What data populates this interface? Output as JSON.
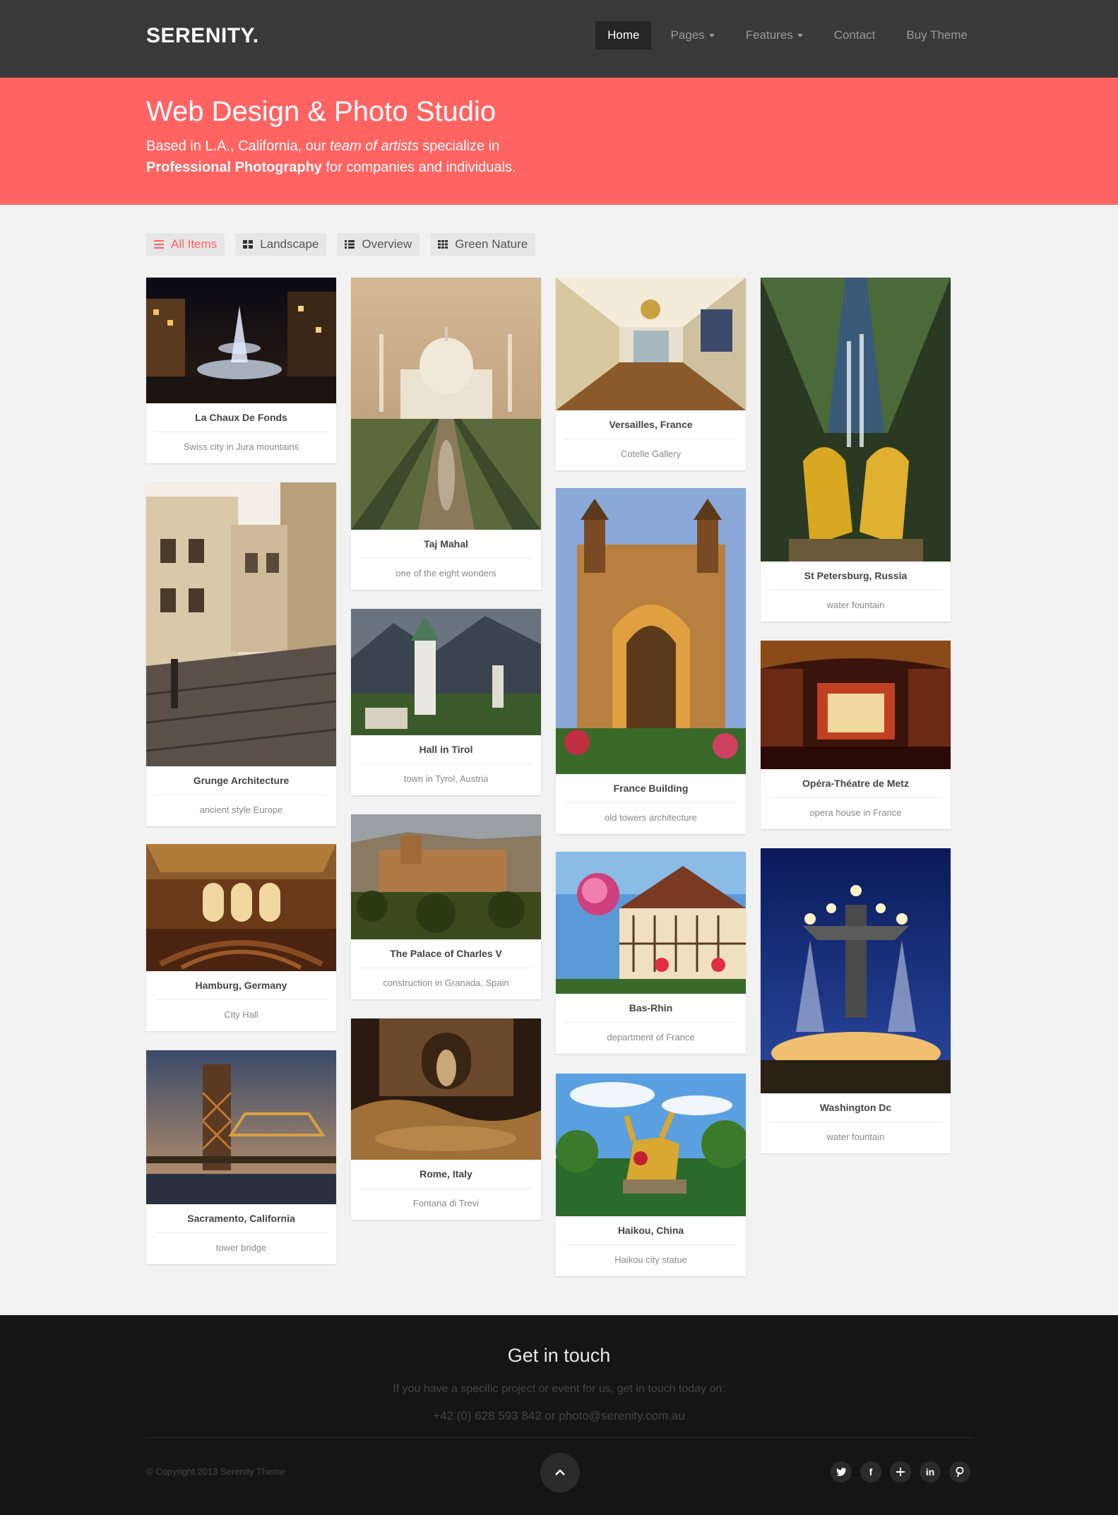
{
  "brand": "SERENITY.",
  "nav": {
    "items": [
      {
        "label": "Home",
        "active": true,
        "dropdown": false
      },
      {
        "label": "Pages",
        "active": false,
        "dropdown": true
      },
      {
        "label": "Features",
        "active": false,
        "dropdown": true
      },
      {
        "label": "Contact",
        "active": false,
        "dropdown": false
      },
      {
        "label": "Buy Theme",
        "active": false,
        "dropdown": false
      }
    ]
  },
  "hero": {
    "title": "Web Design & Photo Studio",
    "sub_part1": "Based in L.A., California, our ",
    "sub_italic": "team of artists",
    "sub_part2": " specialize in",
    "sub_bold": "Professional Photography",
    "sub_part3": " for companies and individuals."
  },
  "filters": [
    {
      "label": "All Items",
      "icon": "list-icon",
      "active": true
    },
    {
      "label": "Landscape",
      "icon": "grid-2x2-icon",
      "active": false
    },
    {
      "label": "Overview",
      "icon": "list-detail-icon",
      "active": false
    },
    {
      "label": "Green Nature",
      "icon": "grid-3x3-icon",
      "active": false
    }
  ],
  "gallery": {
    "columns": [
      [
        {
          "title": "La Chaux De Fonds",
          "desc": "Swiss city in Jura mountains"
        },
        {
          "title": "Grunge Architecture",
          "desc": "ancient style Europe"
        },
        {
          "title": "Hamburg, Germany",
          "desc": "City Hall"
        },
        {
          "title": "Sacramento, California",
          "desc": "tower bridge"
        }
      ],
      [
        {
          "title": "Taj Mahal",
          "desc": "one of the eight wonders"
        },
        {
          "title": "Hall in Tirol",
          "desc": "town in Tyrol, Austria"
        },
        {
          "title": "The Palace of Charles V",
          "desc": "construction in Granada, Spain"
        },
        {
          "title": "Rome, Italy",
          "desc": "Fontana di Trevi"
        }
      ],
      [
        {
          "title": "Versailles, France",
          "desc": "Cotelle Gallery"
        },
        {
          "title": "France Building",
          "desc": "old towers architecture"
        },
        {
          "title": "Bas-Rhin",
          "desc": "department of France"
        },
        {
          "title": "Haikou, China",
          "desc": "Haikou city statue"
        }
      ],
      [
        {
          "title": "St Petersburg, Russia",
          "desc": "water fountain"
        },
        {
          "title": "Opéra-Théatre de Metz",
          "desc": "opera house in France"
        },
        {
          "title": "Washington Dc",
          "desc": "water fountain"
        }
      ]
    ]
  },
  "footer": {
    "title": "Get in touch",
    "line1": "If you have a specific project or event for us, get in touch today on:",
    "line2": "+42 (0) 628 593 842 or photo@serenity.com.au",
    "copyright": "© Copyright 2013 Serenity Theme",
    "socials": [
      "twitter-icon",
      "facebook-icon",
      "google-plus-icon",
      "linkedin-icon",
      "pinterest-icon"
    ]
  },
  "colors": {
    "accent": "#ff6462",
    "nav_bg": "#393939",
    "footer_bg": "#151515"
  }
}
